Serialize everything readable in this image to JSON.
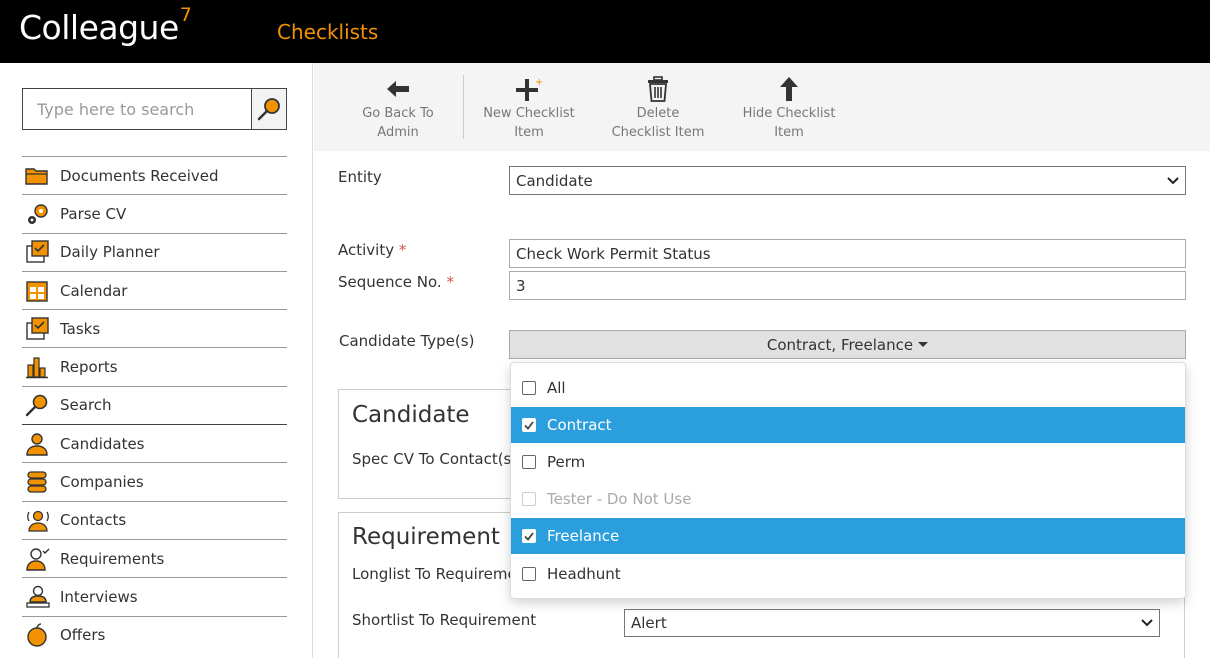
{
  "app": {
    "logo_text": "Colleague",
    "logo_version": "7",
    "page_title": "Checklists"
  },
  "search": {
    "placeholder": "Type here to search"
  },
  "sidebar": {
    "items": [
      {
        "label": "Documents Received",
        "icon": "folder-icon"
      },
      {
        "label": "Parse CV",
        "icon": "gears-icon"
      },
      {
        "label": "Daily Planner",
        "icon": "planner-icon"
      },
      {
        "label": "Calendar",
        "icon": "calendar-icon"
      },
      {
        "label": "Tasks",
        "icon": "tasks-icon"
      },
      {
        "label": "Reports",
        "icon": "bar-chart-icon"
      },
      {
        "label": "Search",
        "icon": "search-icon"
      },
      {
        "label": "Candidates",
        "icon": "person-icon"
      },
      {
        "label": "Companies",
        "icon": "building-icon"
      },
      {
        "label": "Contacts",
        "icon": "contact-icon"
      },
      {
        "label": "Requirements",
        "icon": "requirement-icon"
      },
      {
        "label": "Interviews",
        "icon": "interview-icon"
      },
      {
        "label": "Offers",
        "icon": "apple-icon"
      }
    ]
  },
  "toolbar": {
    "back": {
      "line1": "Go Back To",
      "line2": "Admin"
    },
    "new": {
      "line1": "New Checklist",
      "line2": "Item"
    },
    "delete": {
      "line1": "Delete",
      "line2": "Checklist Item"
    },
    "hide": {
      "line1": "Hide Checklist",
      "line2": "Item"
    }
  },
  "form": {
    "entity_label": "Entity",
    "entity_value": "Candidate",
    "activity_label": "Activity",
    "activity_value": "Check Work Permit Status",
    "sequence_label": "Sequence No.",
    "sequence_value": "3",
    "required_mark": "*",
    "candidate_types_label": "Candidate Type(s)",
    "candidate_types_value": "Contract, Freelance"
  },
  "panels": {
    "candidate": {
      "title": "Candidate",
      "row1_label": "Spec CV To Contact(s)"
    },
    "requirement": {
      "title": "Requirement",
      "row1_label": "Longlist To Requireme",
      "row2_label": "Shortlist To Requirement",
      "row2_value": "Alert"
    }
  },
  "dropdown": {
    "options": [
      {
        "label": "All",
        "checked": false,
        "disabled": false
      },
      {
        "label": "Contract",
        "checked": true,
        "disabled": false
      },
      {
        "label": "Perm",
        "checked": false,
        "disabled": false
      },
      {
        "label": "Tester - Do Not Use",
        "checked": false,
        "disabled": true
      },
      {
        "label": "Freelance",
        "checked": true,
        "disabled": false
      },
      {
        "label": "Headhunt",
        "checked": false,
        "disabled": false
      }
    ]
  },
  "colors": {
    "brand_orange": "#f39200",
    "selection_blue": "#2b9ede",
    "header_black": "#000000"
  }
}
